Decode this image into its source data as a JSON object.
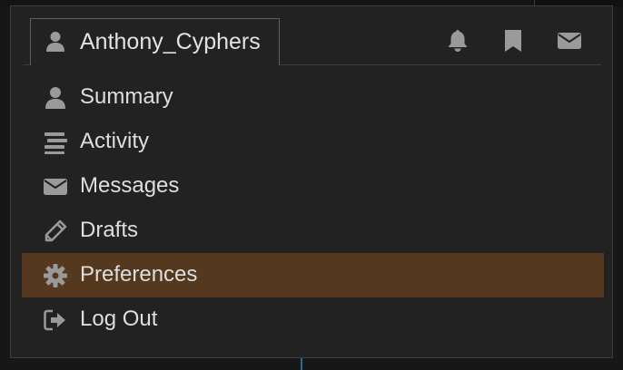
{
  "colors": {
    "panel_bg": "#222222",
    "active_bg": "#55391f",
    "text": "#dedede",
    "icon": "#9a9a9a"
  },
  "user": {
    "name": "Anthony_Cyphers",
    "icon": "user-icon"
  },
  "quick_icons": [
    {
      "name": "bell-icon"
    },
    {
      "name": "bookmark-icon"
    },
    {
      "name": "envelope-icon"
    }
  ],
  "menu": {
    "items": [
      {
        "label": "Summary",
        "icon": "user-icon"
      },
      {
        "label": "Activity",
        "icon": "stream-icon"
      },
      {
        "label": "Messages",
        "icon": "envelope-icon"
      },
      {
        "label": "Drafts",
        "icon": "pencil-icon"
      },
      {
        "label": "Preferences",
        "icon": "gear-icon",
        "active": true
      },
      {
        "label": "Log Out",
        "icon": "sign-out-icon"
      }
    ]
  }
}
